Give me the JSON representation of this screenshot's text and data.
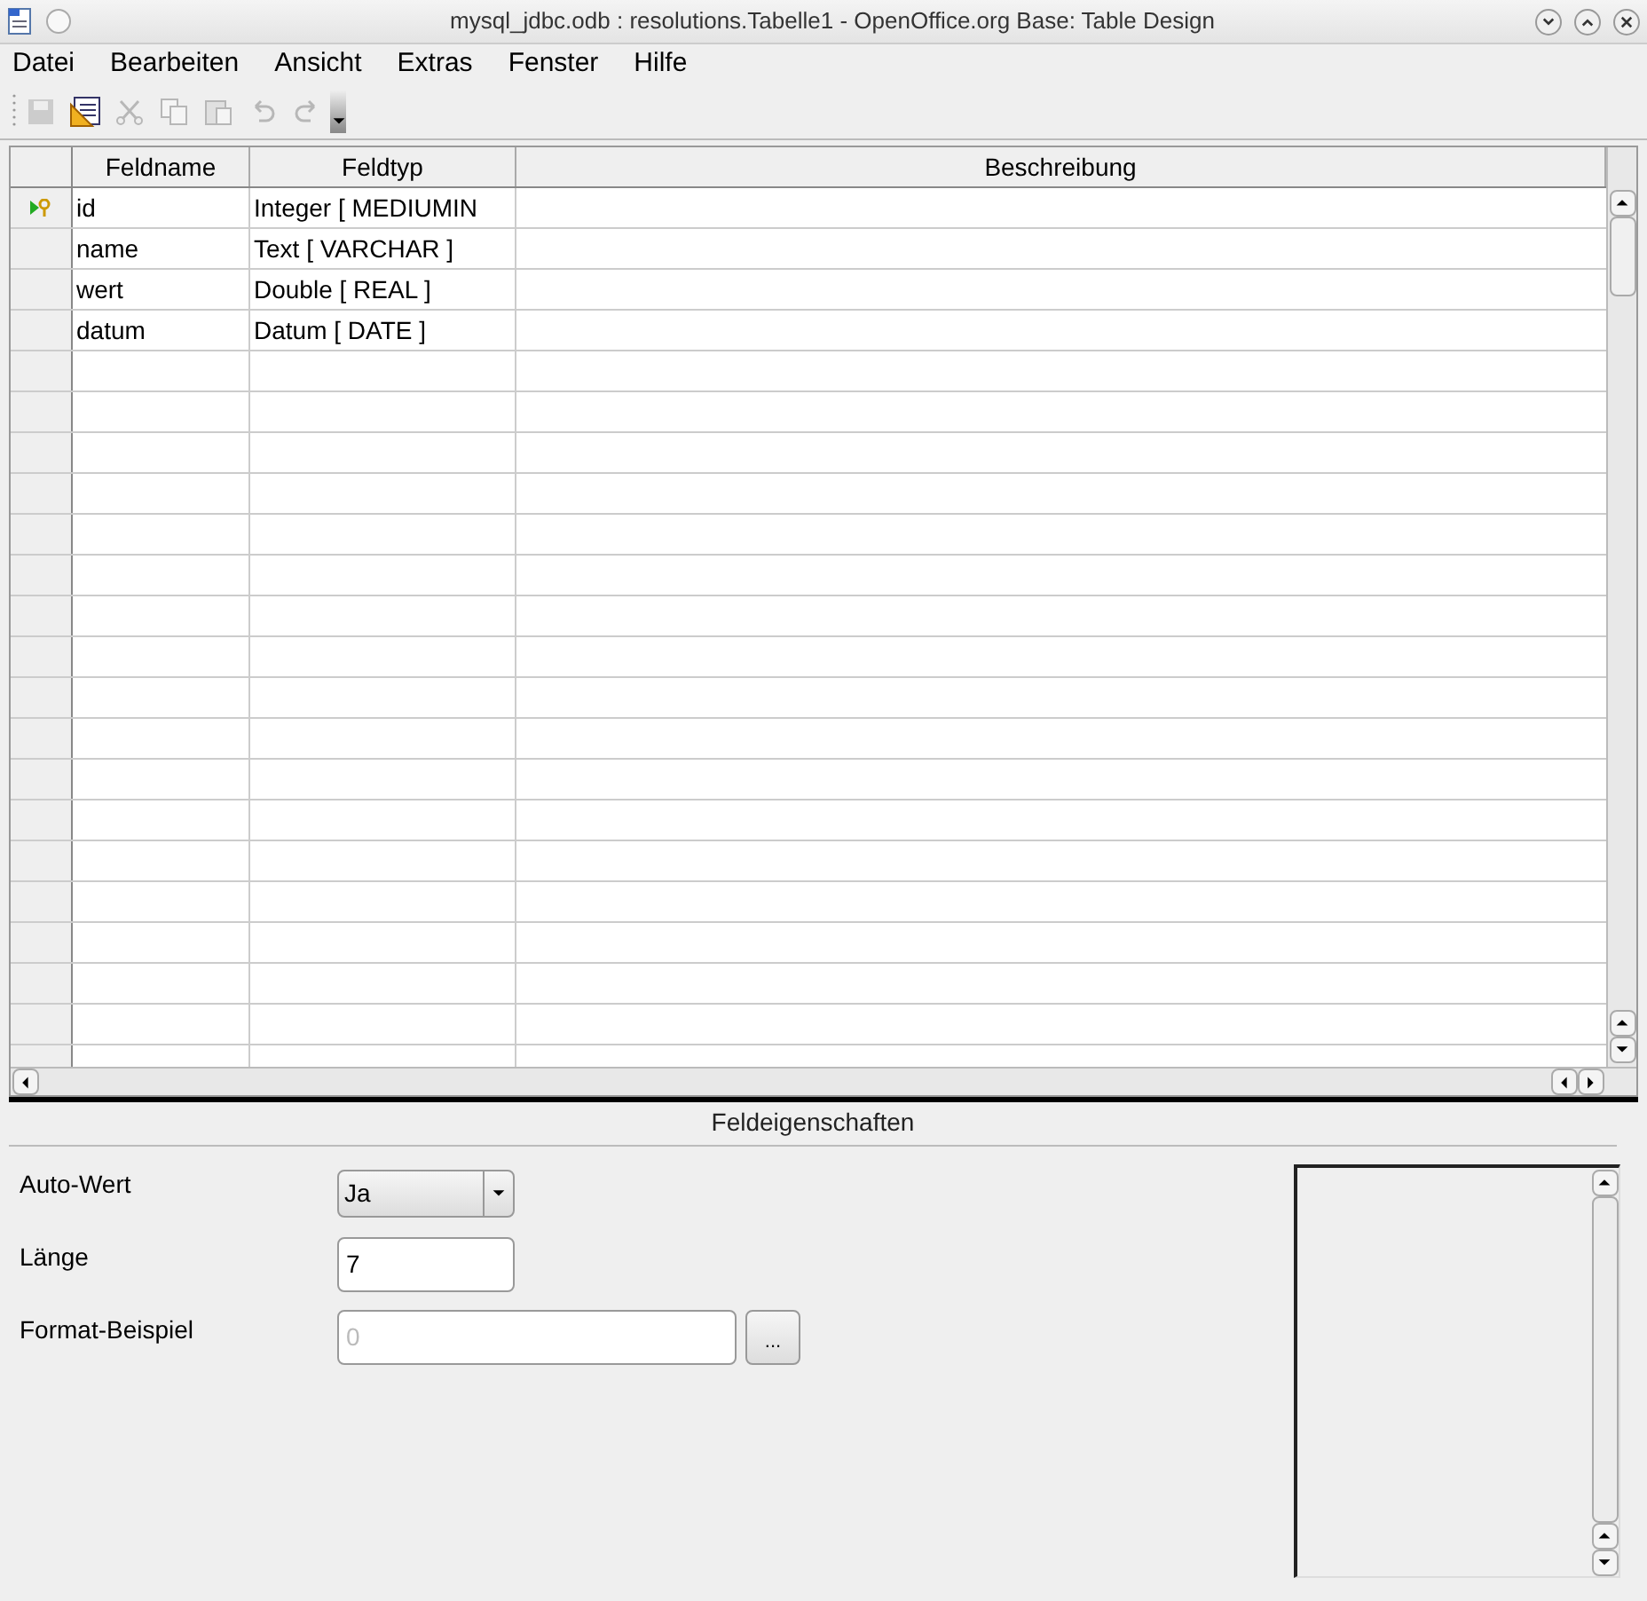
{
  "window": {
    "title": "mysql_jdbc.odb : resolutions.Tabelle1 - OpenOffice.org Base: Table Design"
  },
  "menu": [
    "Datei",
    "Bearbeiten",
    "Ansicht",
    "Extras",
    "Fenster",
    "Hilfe"
  ],
  "table": {
    "columns": [
      "Feldname",
      "Feldtyp",
      "Beschreibung"
    ],
    "rows": [
      {
        "name": "id",
        "type": "Integer [ MEDIUMIN",
        "primary_key": true
      },
      {
        "name": "name",
        "type": "Text [ VARCHAR ]",
        "primary_key": false
      },
      {
        "name": "wert",
        "type": "Double [ REAL ]",
        "primary_key": false
      },
      {
        "name": "datum",
        "type": "Datum [ DATE ]",
        "primary_key": false
      }
    ]
  },
  "properties": {
    "title": "Feldeigenschaften",
    "fields": [
      {
        "kind": "dropdown",
        "label": "Auto-Wert",
        "value": "Ja",
        "disabled": false
      },
      {
        "kind": "text",
        "label": "Länge",
        "value": "7",
        "disabled": false
      },
      {
        "kind": "format",
        "label": "Format-Beispiel",
        "value": "0",
        "disabled": true,
        "button": "..."
      }
    ]
  }
}
